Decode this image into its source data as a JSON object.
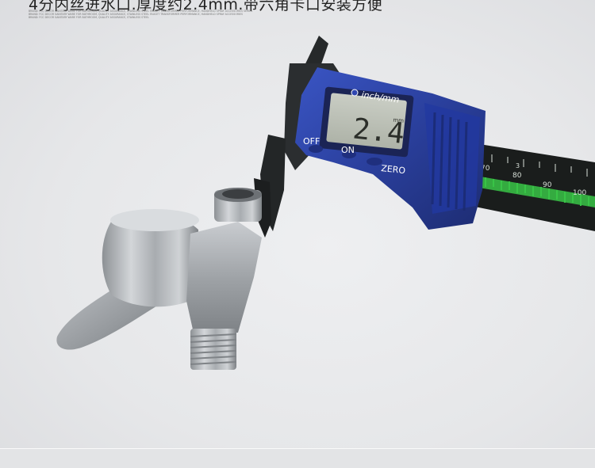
{
  "headline": "4分内丝进水口.厚度约2.4mm.带六角卡口安装方便",
  "fine_print": [
    "BRAND: FCC DECOR SANITARY WARE FOR BATHROOM, QUALITY ASSURANCE, STAINLESS STEEL FAUCET TRANSFORMER PERFORMANCE, HANDHELD SPRAY ACCESSORIES SERIES",
    "BRAND: FCC DECOR SANITARY WARE FOR BATHROOM, QUALITY ASSURANCE, STAINLESS STEEL FAUCET TRANSFORMER PERFORMANCE, HANDHELD SPRAY ACCESSORIES",
    "BRAND: FCC DECOR SANITARY WARE FOR BATHROOM, QUALITY ASSURANCE, STAINLESS STEEL"
  ],
  "caliper": {
    "unit_label": "inch/mm",
    "reading": "2.4",
    "mm_indicator": "mm",
    "btn_off": "OFF",
    "btn_on": "ON",
    "btn_zero": "ZERO",
    "scale_numbers": [
      "70",
      "80",
      "90",
      "100"
    ],
    "scale_small": "3",
    "body_color": "#2a3f9c",
    "scale_color": "#1a1d1c",
    "scale_green": "#39c447"
  },
  "icons": {
    "product": "stainless-valve-icon",
    "tool": "digital-caliper-icon"
  }
}
